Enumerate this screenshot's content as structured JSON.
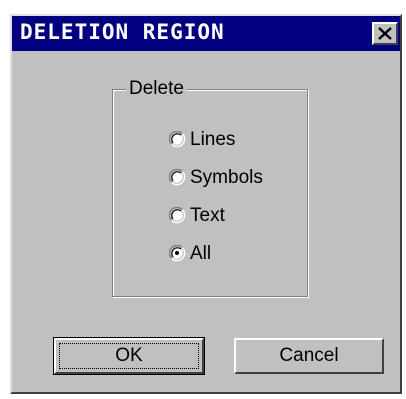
{
  "window": {
    "title": "DELETION REGION",
    "close_glyph": "✕",
    "close_icon": "close-icon"
  },
  "group": {
    "label": "Delete"
  },
  "radios": [
    {
      "label": "Lines",
      "checked": false
    },
    {
      "label": "Symbols",
      "checked": false
    },
    {
      "label": "Text",
      "checked": false
    },
    {
      "label": "All",
      "checked": true
    }
  ],
  "buttons": {
    "ok_label": "OK",
    "cancel_label": "Cancel"
  },
  "colors": {
    "titlebar": "#000080",
    "face": "#c0c0c0"
  }
}
